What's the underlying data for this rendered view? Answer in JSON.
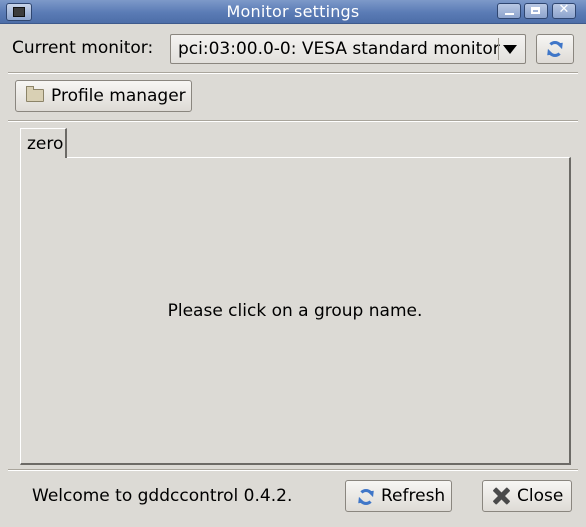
{
  "window": {
    "title": "Monitor settings",
    "controls": {
      "minimize_icon": "minimize-icon",
      "maximize_icon": "maximize-icon",
      "close_icon": "close-icon"
    }
  },
  "monitor": {
    "label": "Current monitor:",
    "selected": "pci:03:00.0-0: VESA standard monitor",
    "refresh_icon": "refresh-icon"
  },
  "profile_manager": {
    "label": "Profile manager",
    "icon": "folder-icon"
  },
  "tabs": [
    {
      "label": "zero",
      "active": true
    }
  ],
  "panel": {
    "message": "Please click on a group name."
  },
  "statusbar": {
    "text": "Welcome to gddccontrol 0.4.2."
  },
  "buttons": {
    "refresh": "Refresh",
    "close": "Close"
  },
  "colors": {
    "titlebar": "#5a7bb5",
    "background": "#dcdad5",
    "icon_blue": "#3f76c8"
  }
}
